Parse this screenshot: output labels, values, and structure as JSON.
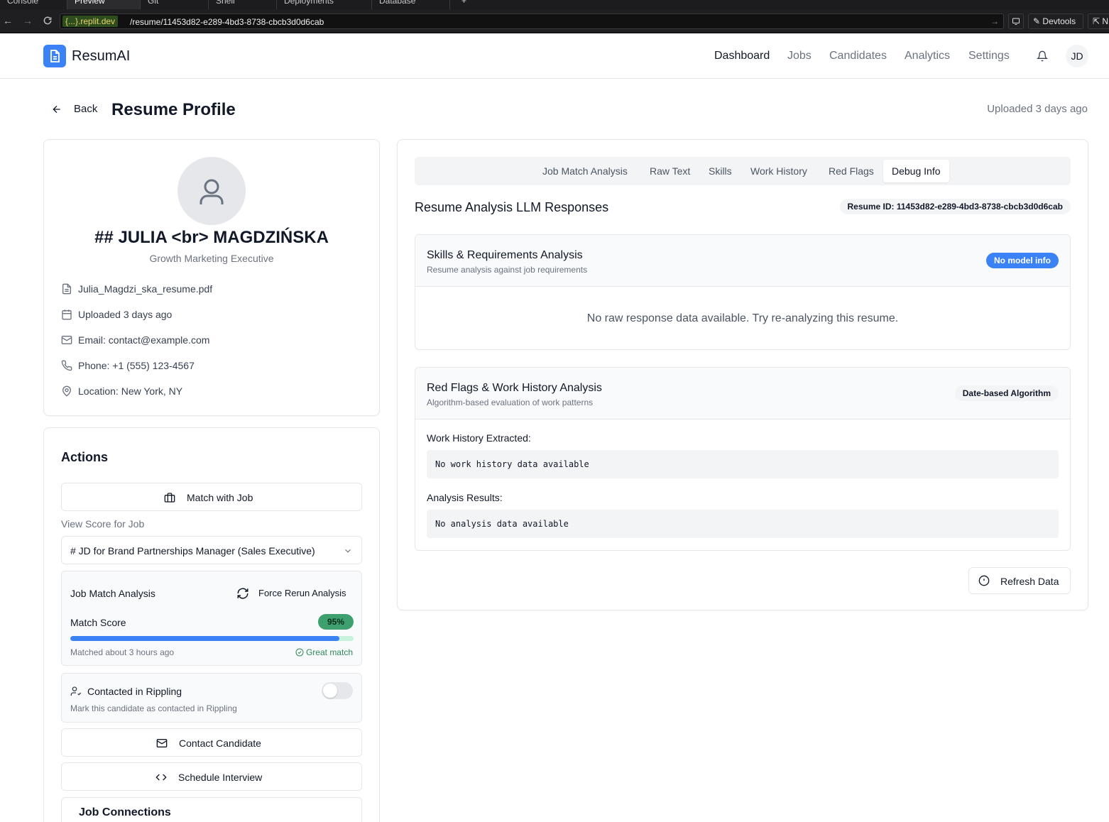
{
  "browser": {
    "tabs": [
      "Console",
      "Preview",
      "Git",
      "Shell",
      "Deployments",
      "Database",
      "+"
    ],
    "url_domain": "{...}.replit.dev",
    "url_path": "/resume/11453d82-e289-4bd3-8738-cbcb3d0d6cab",
    "devtools_label": "Devtools",
    "right_partial": "N"
  },
  "header": {
    "brand": "ResumAI",
    "nav": [
      "Dashboard",
      "Jobs",
      "Candidates",
      "Analytics",
      "Settings"
    ],
    "active_nav": "Dashboard",
    "avatar_initials": "JD"
  },
  "page": {
    "back_label": "Back",
    "title": "Resume Profile",
    "uploaded": "Uploaded 3 days ago"
  },
  "profile": {
    "name": "## JULIA <br> MAGDZIŃSKA",
    "role": "Growth Marketing Executive",
    "file": "Julia_Magdzi_ska_resume.pdf",
    "uploaded": "Uploaded 3 days ago",
    "email": "Email: contact@example.com",
    "phone": "Phone: +1 (555) 123-4567",
    "location": "Location: New York, NY"
  },
  "actions": {
    "title": "Actions",
    "match_button": "Match with Job",
    "view_score_label": "View Score for Job",
    "selected_job": "# JD for Brand Partnerships Manager (Sales Executive)",
    "job_match": {
      "title": "Job Match Analysis",
      "rerun_label": "Force Rerun Analysis",
      "score_label": "Match Score",
      "score_text": "95%",
      "score_value": 95,
      "matched_time": "Matched about 3 hours ago",
      "match_quality": "Great match"
    },
    "rippling": {
      "title": "Contacted in Rippling",
      "subtitle": "Mark this candidate as contacted in Rippling",
      "toggled": false
    },
    "contact_button": "Contact Candidate",
    "schedule_button": "Schedule Interview",
    "job_connections_title": "Job Connections"
  },
  "debug": {
    "tabs": [
      "Job Match Analysis",
      "Raw Text",
      "Skills",
      "Work History",
      "Red Flags",
      "Debug Info"
    ],
    "active_tab": "Debug Info",
    "title": "Resume Analysis LLM Responses",
    "resume_id": "Resume ID: 11453d82-e289-4bd3-8738-cbcb3d0d6cab",
    "skills_section": {
      "title": "Skills & Requirements Analysis",
      "subtitle": "Resume analysis against job requirements",
      "badge": "No model info",
      "empty": "No raw response data available. Try re-analyzing this resume."
    },
    "redflags_section": {
      "title": "Red Flags & Work History Analysis",
      "subtitle": "Algorithm-based evaluation of work patterns",
      "badge": "Date-based Algorithm",
      "work_history_label": "Work History Extracted:",
      "work_history_value": "No work history data available",
      "analysis_label": "Analysis Results:",
      "analysis_value": "No analysis data available"
    },
    "refresh_label": "Refresh Data"
  },
  "colors": {
    "accent": "#3b82f6",
    "success": "#3fa06f",
    "border": "#e5e7eb"
  }
}
